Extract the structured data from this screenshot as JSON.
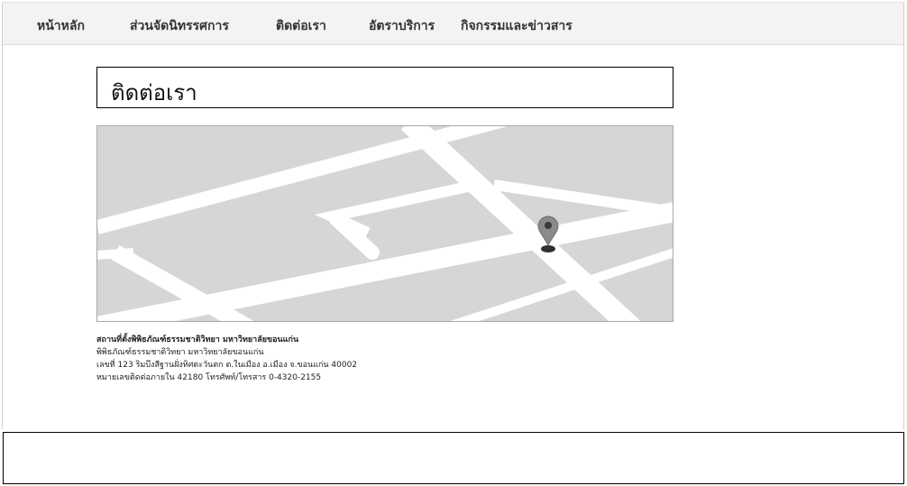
{
  "nav": {
    "items": [
      {
        "label": "หน้าหลัก"
      },
      {
        "label": "ส่วนจัดนิทรรศการ"
      },
      {
        "label": "ติดต่อเรา"
      },
      {
        "label": "อัตราบริการ"
      },
      {
        "label": "กิจกรรมและข่าวสาร"
      }
    ]
  },
  "page": {
    "title": "ติดต่อเรา"
  },
  "map": {
    "marker_icon": "map-pin-icon",
    "background_color": "#d6d6d6",
    "road_color": "#ffffff",
    "marker_color": "#8a8a8a"
  },
  "address": {
    "heading": "สถานที่ตั้งพิพิธภัณฑ์ธรรมชาติวิทยา มหาวิทยาลัยขอนแก่น",
    "line1": "พิพิธภัณฑ์ธรรมชาติวิทยา มหาวิทยาลัยขอนแก่น",
    "line2": "เลขที่ 123 ริมบึงสีฐานฝั่งทิศตะวันตก ต.ในเมือง อ.เมือง จ.ขอนแก่น 40002",
    "line3": "หมายเลขติดต่อภายใน 42180 โทรศัพท์/โทรสาร 0-4320-2155"
  }
}
